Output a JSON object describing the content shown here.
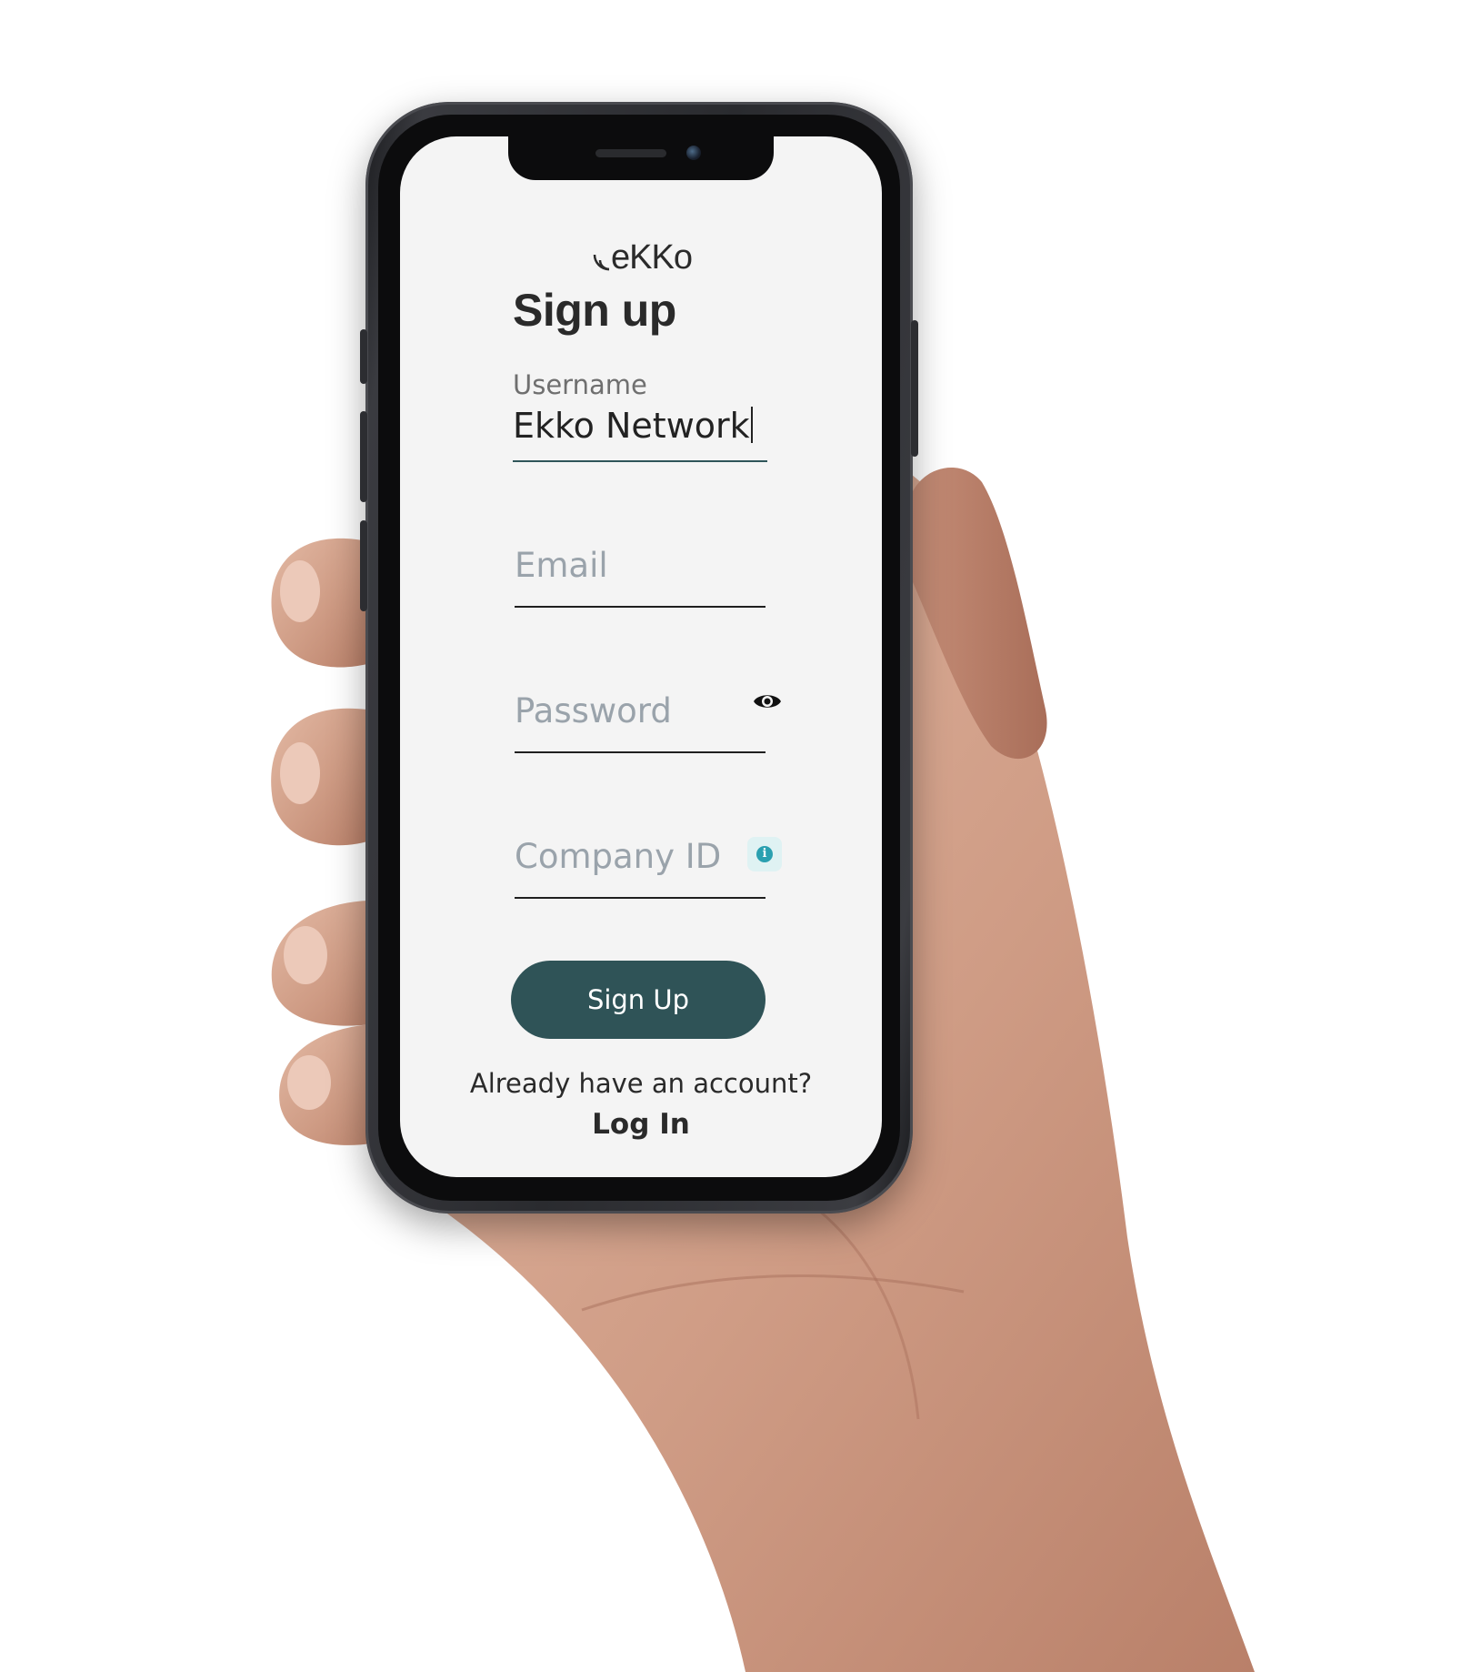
{
  "app": {
    "logo_text": "eKKo"
  },
  "signup": {
    "title": "Sign up",
    "username": {
      "label": "Username",
      "value": "Ekko Network"
    },
    "email": {
      "placeholder": "Email"
    },
    "password": {
      "placeholder": "Password",
      "toggle_icon": "eye-icon"
    },
    "company_id": {
      "placeholder": "Company ID",
      "info_icon": "info-icon"
    },
    "submit_label": "Sign Up",
    "already_text": "Already have an account?",
    "login_label": "Log In"
  },
  "colors": {
    "screen_background": "#f4f4f4",
    "button_background": "#2f5357",
    "button_text": "#ffffff",
    "placeholder_text": "#9aa3ab",
    "info_badge": "#2aa0b0"
  }
}
